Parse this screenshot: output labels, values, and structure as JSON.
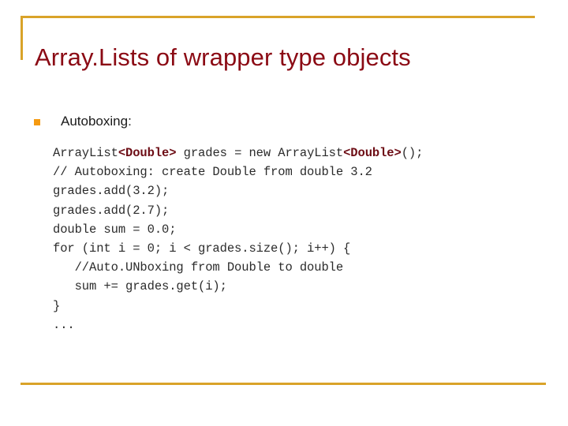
{
  "slide": {
    "title": "Array.Lists of wrapper type objects",
    "accent_gold": "#d9a329",
    "title_color": "#8b0a14",
    "bullet_color": "#f59a11",
    "code_color": "#2b2b2b",
    "code_emphasis_color": "#6d0d15"
  },
  "body": {
    "bullets": [
      {
        "marker": "square-bullet",
        "label": "Autoboxing:"
      }
    ]
  },
  "code": {
    "language": "java",
    "lines": [
      {
        "segments": [
          {
            "text": "ArrayList",
            "emphasis": false
          },
          {
            "text": "<Double>",
            "emphasis": true
          },
          {
            "text": " grades = new ArrayList",
            "emphasis": false
          },
          {
            "text": "<Double>",
            "emphasis": true
          },
          {
            "text": "();",
            "emphasis": false
          }
        ]
      },
      {
        "segments": [
          {
            "text": "// Autoboxing: create Double from double 3.2",
            "emphasis": false
          }
        ]
      },
      {
        "segments": [
          {
            "text": "grades.add(3.2);",
            "emphasis": false
          }
        ]
      },
      {
        "segments": [
          {
            "text": "grades.add(2.7);",
            "emphasis": false
          }
        ]
      },
      {
        "segments": [
          {
            "text": "double sum = 0.0;",
            "emphasis": false
          }
        ]
      },
      {
        "segments": [
          {
            "text": "for (int i = 0; i < grades.size(); i++) {",
            "emphasis": false
          }
        ]
      },
      {
        "segments": [
          {
            "text": "   //Auto.UNboxing from Double to double",
            "emphasis": false
          }
        ]
      },
      {
        "segments": [
          {
            "text": "   sum += grades.get(i);",
            "emphasis": false
          }
        ]
      },
      {
        "segments": [
          {
            "text": "}",
            "emphasis": false
          }
        ]
      },
      {
        "segments": [
          {
            "text": "...",
            "emphasis": false
          }
        ]
      }
    ]
  }
}
